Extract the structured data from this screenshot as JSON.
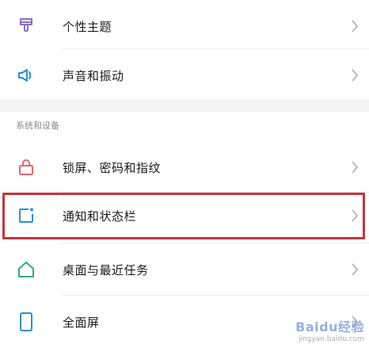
{
  "rows_top": [
    {
      "label": "个性主题",
      "icon": "theme-brush-icon",
      "color": "#8a6fbf"
    },
    {
      "label": "声音和振动",
      "icon": "speaker-icon",
      "color": "#2b8fd6"
    }
  ],
  "section": {
    "header": "系统和设备"
  },
  "rows_bottom": [
    {
      "label": "锁屏、密码和指纹",
      "icon": "lock-icon",
      "color": "#e0696f"
    },
    {
      "label": "通知和状态栏",
      "icon": "notification-icon",
      "color": "#2b8fd6"
    },
    {
      "label": "桌面与最近任务",
      "icon": "home-icon",
      "color": "#2fa98c"
    },
    {
      "label": "全面屏",
      "icon": "phone-screen-icon",
      "color": "#2b8fd6"
    }
  ],
  "watermark": {
    "text": "Baidu经验",
    "sub": "jingyan.baidu.com"
  },
  "colors": {
    "highlight": "#c8333b",
    "divider": "#ececec",
    "section_bg": "#f5f5f5"
  }
}
